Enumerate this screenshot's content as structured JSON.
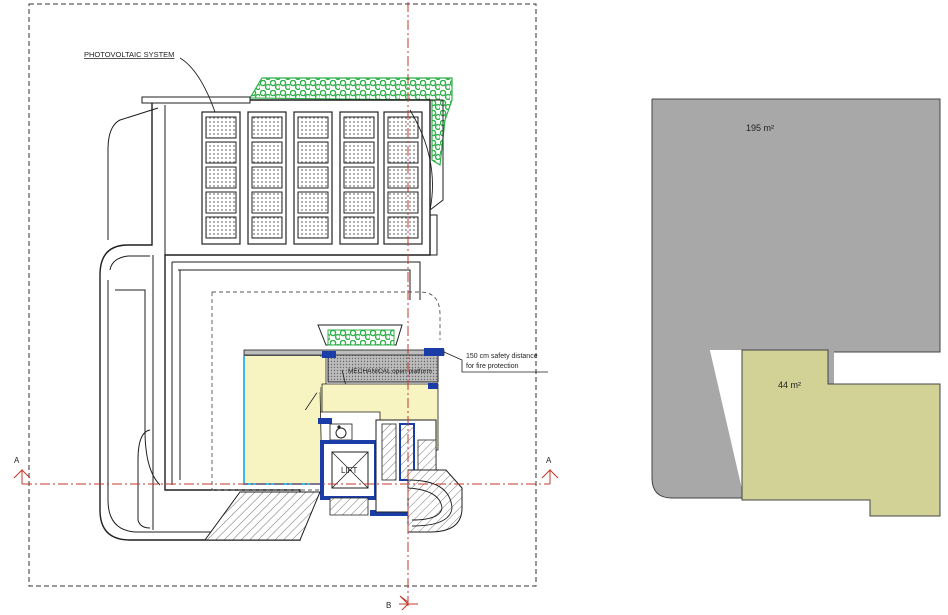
{
  "plan": {
    "pv_label": "PHOTOVOLTAIC SYSTEM",
    "mechanical_label": "MECHANICAL open platform",
    "lift_label": "LIFT",
    "safety_line1": "150 cm safety distance",
    "safety_line2": "for fire protection",
    "section_a": "A",
    "section_b": "B",
    "colors": {
      "line": "#1f1f1f",
      "green": "#2fb04a",
      "yellow": "#f8f4c2",
      "blue": "#1b3da8",
      "cyan": "#3fb8e8",
      "red": "#c0392b",
      "hatch": "#8a8a8a"
    }
  },
  "areas": {
    "upper_label": "195 m²",
    "lower_label": "44 m²",
    "colors": {
      "grey": "#a8a8a8",
      "olive": "#d2d296",
      "line": "#444444"
    }
  }
}
